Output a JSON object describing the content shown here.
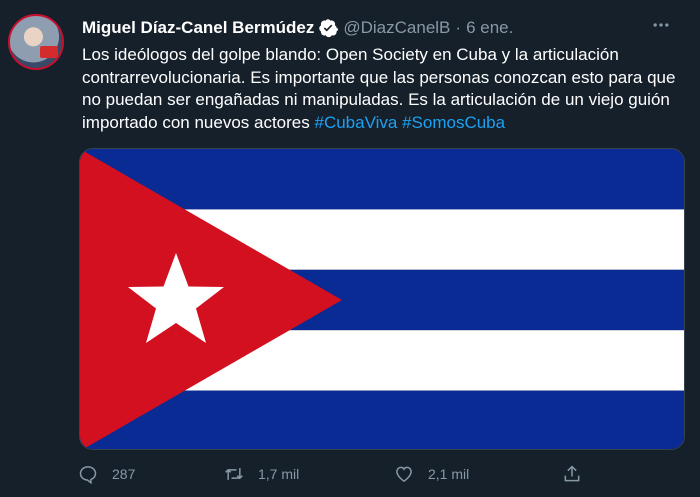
{
  "tweet": {
    "author_name": "Miguel Díaz-Canel Bermúdez",
    "handle": "@DiazCanelB",
    "separator": "·",
    "date": "6 ene.",
    "text": "Los ideólogos del golpe blando: Open Society en Cuba y la articulación contrarrevolucionaria. Es importante que las personas conozcan esto para que no puedan ser engañadas ni manipuladas. Es la articulación de un viejo guión importado con nuevos actores",
    "hashtags": [
      "#CubaViva",
      "#SomosCuba"
    ],
    "media": {
      "description_icon": "cuban-flag"
    }
  },
  "actions": {
    "replies": "287",
    "retweets": "1,7 mil",
    "likes": "2,1 mil"
  },
  "colors": {
    "background": "#15202b",
    "secondary_text": "#8899a6",
    "hashtag": "#1da1f2",
    "flag_blue": "#0a2a94",
    "flag_red": "#d3101f",
    "flag_white": "#ffffff"
  }
}
